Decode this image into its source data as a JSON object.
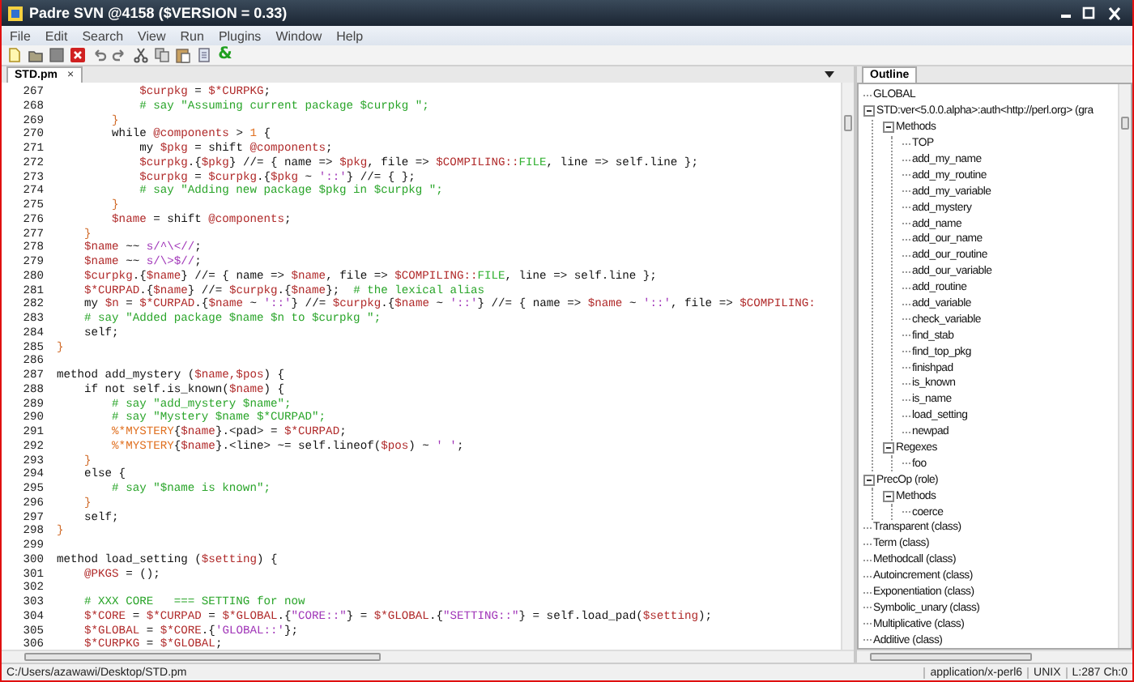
{
  "window": {
    "title": "Padre SVN @4158 ($VERSION = 0.33)"
  },
  "menu": [
    "File",
    "Edit",
    "Search",
    "View",
    "Run",
    "Plugins",
    "Window",
    "Help"
  ],
  "toolbar": [
    {
      "kind": "new"
    },
    {
      "kind": "open"
    },
    {
      "kind": "save"
    },
    {
      "kind": "close"
    },
    {
      "kind": "undo"
    },
    {
      "kind": "redo"
    },
    {
      "kind": "cut"
    },
    {
      "kind": "copy"
    },
    {
      "kind": "paste"
    },
    {
      "kind": "doc"
    },
    {
      "kind": "glyph",
      "text": "&"
    }
  ],
  "editor_tabs": [
    {
      "label": "STD.pm",
      "close": "×",
      "selected": true
    }
  ],
  "editor": {
    "lines": [
      {
        "number": "267",
        "segments": [
          {
            "kind": "var",
            "text": "            $curpkg"
          },
          {
            "kind": "plain",
            "text": " = "
          },
          {
            "kind": "var",
            "text": "$*CURPKG"
          },
          {
            "kind": "plain",
            "text": ";"
          }
        ]
      },
      {
        "number": "268",
        "segments": [
          {
            "kind": "comment",
            "text": "            # say \"Assuming current package $curpkg \";"
          }
        ]
      },
      {
        "number": "269",
        "segments": [
          {
            "kind": "brace",
            "text": "        }"
          }
        ]
      },
      {
        "number": "270",
        "segments": [
          {
            "kind": "plain",
            "text": "        while "
          },
          {
            "kind": "var",
            "text": "@components"
          },
          {
            "kind": "plain",
            "text": " > "
          },
          {
            "kind": "number",
            "text": "1"
          },
          {
            "kind": "plain",
            "text": " {"
          }
        ]
      },
      {
        "number": "271",
        "segments": [
          {
            "kind": "plain",
            "text": "            my "
          },
          {
            "kind": "var",
            "text": "$pkg"
          },
          {
            "kind": "plain",
            "text": " = shift "
          },
          {
            "kind": "var",
            "text": "@components"
          },
          {
            "kind": "plain",
            "text": ";"
          }
        ]
      },
      {
        "number": "272",
        "segments": [
          {
            "kind": "var",
            "text": "            $curpkg"
          },
          {
            "kind": "plain",
            "text": ".{"
          },
          {
            "kind": "var",
            "text": "$pkg"
          },
          {
            "kind": "plain",
            "text": "} //= { name => "
          },
          {
            "kind": "var",
            "text": "$pkg"
          },
          {
            "kind": "plain",
            "text": ", file => "
          },
          {
            "kind": "var",
            "text": "$COMPILING::"
          },
          {
            "kind": "const",
            "text": "FILE"
          },
          {
            "kind": "plain",
            "text": ", line => self.line };"
          }
        ]
      },
      {
        "number": "273",
        "segments": [
          {
            "kind": "var",
            "text": "            $curpkg"
          },
          {
            "kind": "plain",
            "text": " = "
          },
          {
            "kind": "var",
            "text": "$curpkg"
          },
          {
            "kind": "plain",
            "text": ".{"
          },
          {
            "kind": "var",
            "text": "$pkg"
          },
          {
            "kind": "plain",
            "text": " ~ "
          },
          {
            "kind": "string",
            "text": "'::'"
          },
          {
            "kind": "plain",
            "text": "} //= { };"
          }
        ]
      },
      {
        "number": "274",
        "segments": [
          {
            "kind": "comment",
            "text": "            # say \"Adding new package $pkg in $curpkg \";"
          }
        ]
      },
      {
        "number": "275",
        "segments": [
          {
            "kind": "brace",
            "text": "        }"
          }
        ]
      },
      {
        "number": "276",
        "segments": [
          {
            "kind": "var",
            "text": "        $name"
          },
          {
            "kind": "plain",
            "text": " = shift "
          },
          {
            "kind": "var",
            "text": "@components"
          },
          {
            "kind": "plain",
            "text": ";"
          }
        ]
      },
      {
        "number": "277",
        "segments": [
          {
            "kind": "brace",
            "text": "    }"
          }
        ]
      },
      {
        "number": "278",
        "segments": [
          {
            "kind": "var",
            "text": "    $name"
          },
          {
            "kind": "plain",
            "text": " ~~ "
          },
          {
            "kind": "string",
            "text": "s/^\\<//"
          },
          {
            "kind": "plain",
            "text": ";"
          }
        ]
      },
      {
        "number": "279",
        "segments": [
          {
            "kind": "var",
            "text": "    $name"
          },
          {
            "kind": "plain",
            "text": " ~~ "
          },
          {
            "kind": "string",
            "text": "s/\\>$//"
          },
          {
            "kind": "plain",
            "text": ";"
          }
        ]
      },
      {
        "number": "280",
        "segments": [
          {
            "kind": "var",
            "text": "    $curpkg"
          },
          {
            "kind": "plain",
            "text": ".{"
          },
          {
            "kind": "var",
            "text": "$name"
          },
          {
            "kind": "plain",
            "text": "} //= { name => "
          },
          {
            "kind": "var",
            "text": "$name"
          },
          {
            "kind": "plain",
            "text": ", file => "
          },
          {
            "kind": "var",
            "text": "$COMPILING::"
          },
          {
            "kind": "const",
            "text": "FILE"
          },
          {
            "kind": "plain",
            "text": ", line => self.line };"
          }
        ]
      },
      {
        "number": "281",
        "segments": [
          {
            "kind": "var",
            "text": "    $*CURPAD"
          },
          {
            "kind": "plain",
            "text": ".{"
          },
          {
            "kind": "var",
            "text": "$name"
          },
          {
            "kind": "plain",
            "text": "} //= "
          },
          {
            "kind": "var",
            "text": "$curpkg"
          },
          {
            "kind": "plain",
            "text": ".{"
          },
          {
            "kind": "var",
            "text": "$name"
          },
          {
            "kind": "plain",
            "text": "};  "
          },
          {
            "kind": "comment",
            "text": "# the lexical alias"
          }
        ]
      },
      {
        "number": "282",
        "segments": [
          {
            "kind": "plain",
            "text": "    my "
          },
          {
            "kind": "var",
            "text": "$n"
          },
          {
            "kind": "plain",
            "text": " = "
          },
          {
            "kind": "var",
            "text": "$*CURPAD"
          },
          {
            "kind": "plain",
            "text": ".{"
          },
          {
            "kind": "var",
            "text": "$name"
          },
          {
            "kind": "plain",
            "text": " ~ "
          },
          {
            "kind": "string",
            "text": "'::'"
          },
          {
            "kind": "plain",
            "text": "} //= "
          },
          {
            "kind": "var",
            "text": "$curpkg"
          },
          {
            "kind": "plain",
            "text": ".{"
          },
          {
            "kind": "var",
            "text": "$name"
          },
          {
            "kind": "plain",
            "text": " ~ "
          },
          {
            "kind": "string",
            "text": "'::'"
          },
          {
            "kind": "plain",
            "text": "} //= { name => "
          },
          {
            "kind": "var",
            "text": "$name"
          },
          {
            "kind": "plain",
            "text": " ~ "
          },
          {
            "kind": "string",
            "text": "'::'"
          },
          {
            "kind": "plain",
            "text": ", file => "
          },
          {
            "kind": "var",
            "text": "$COMPILING:"
          }
        ]
      },
      {
        "number": "283",
        "segments": [
          {
            "kind": "comment",
            "text": "    # say \"Added package $name $n to $curpkg \";"
          }
        ]
      },
      {
        "number": "284",
        "segments": [
          {
            "kind": "plain",
            "text": "    self;"
          }
        ]
      },
      {
        "number": "285",
        "segments": [
          {
            "kind": "brace",
            "text": "}"
          }
        ]
      },
      {
        "number": "286"
      },
      {
        "number": "287",
        "segments": [
          {
            "kind": "plain",
            "text": "method add_mystery ("
          },
          {
            "kind": "var",
            "text": "$name,$pos"
          },
          {
            "kind": "plain",
            "text": ") {"
          }
        ]
      },
      {
        "number": "288",
        "segments": [
          {
            "kind": "plain",
            "text": "    if not self.is_known("
          },
          {
            "kind": "var",
            "text": "$name"
          },
          {
            "kind": "plain",
            "text": ") {"
          }
        ]
      },
      {
        "number": "289",
        "segments": [
          {
            "kind": "comment",
            "text": "        # say \"add_mystery $name\";"
          }
        ]
      },
      {
        "number": "290",
        "segments": [
          {
            "kind": "comment",
            "text": "        # say \"Mystery $name $*CURPAD\";"
          }
        ]
      },
      {
        "number": "291",
        "segments": [
          {
            "kind": "number",
            "text": "        %*MYSTERY"
          },
          {
            "kind": "plain",
            "text": "{"
          },
          {
            "kind": "var",
            "text": "$name"
          },
          {
            "kind": "plain",
            "text": "}.<pad> = "
          },
          {
            "kind": "var",
            "text": "$*CURPAD"
          },
          {
            "kind": "plain",
            "text": ";"
          }
        ]
      },
      {
        "number": "292",
        "segments": [
          {
            "kind": "number",
            "text": "        %*MYSTERY"
          },
          {
            "kind": "plain",
            "text": "{"
          },
          {
            "kind": "var",
            "text": "$name"
          },
          {
            "kind": "plain",
            "text": "}.<line> ~= self.lineof("
          },
          {
            "kind": "var",
            "text": "$pos"
          },
          {
            "kind": "plain",
            "text": ") ~ "
          },
          {
            "kind": "string",
            "text": "' '"
          },
          {
            "kind": "plain",
            "text": ";"
          }
        ]
      },
      {
        "number": "293",
        "segments": [
          {
            "kind": "brace",
            "text": "    }"
          }
        ]
      },
      {
        "number": "294",
        "segments": [
          {
            "kind": "plain",
            "text": "    else {"
          }
        ]
      },
      {
        "number": "295",
        "segments": [
          {
            "kind": "comment",
            "text": "        # say \"$name is known\";"
          }
        ]
      },
      {
        "number": "296",
        "segments": [
          {
            "kind": "brace",
            "text": "    }"
          }
        ]
      },
      {
        "number": "297",
        "segments": [
          {
            "kind": "plain",
            "text": "    self;"
          }
        ]
      },
      {
        "number": "298",
        "segments": [
          {
            "kind": "brace",
            "text": "}"
          }
        ]
      },
      {
        "number": "299"
      },
      {
        "number": "300",
        "segments": [
          {
            "kind": "plain",
            "text": "method load_setting ("
          },
          {
            "kind": "var",
            "text": "$setting"
          },
          {
            "kind": "plain",
            "text": ") {"
          }
        ]
      },
      {
        "number": "301",
        "segments": [
          {
            "kind": "var",
            "text": "    @PKGS"
          },
          {
            "kind": "plain",
            "text": " = ();"
          }
        ]
      },
      {
        "number": "302"
      },
      {
        "number": "303",
        "segments": [
          {
            "kind": "comment",
            "text": "    # XXX CORE   === SETTING for now"
          }
        ]
      },
      {
        "number": "304",
        "segments": [
          {
            "kind": "var",
            "text": "    $*CORE"
          },
          {
            "kind": "plain",
            "text": " = "
          },
          {
            "kind": "var",
            "text": "$*CURPAD"
          },
          {
            "kind": "plain",
            "text": " = "
          },
          {
            "kind": "var",
            "text": "$*GLOBAL"
          },
          {
            "kind": "plain",
            "text": ".{"
          },
          {
            "kind": "string",
            "text": "\"CORE::\""
          },
          {
            "kind": "plain",
            "text": "} = "
          },
          {
            "kind": "var",
            "text": "$*GLOBAL"
          },
          {
            "kind": "plain",
            "text": ".{"
          },
          {
            "kind": "string",
            "text": "\"SETTING::\""
          },
          {
            "kind": "plain",
            "text": "} = self.load_pad("
          },
          {
            "kind": "var",
            "text": "$setting"
          },
          {
            "kind": "plain",
            "text": ");"
          }
        ]
      },
      {
        "number": "305",
        "segments": [
          {
            "kind": "var",
            "text": "    $*GLOBAL"
          },
          {
            "kind": "plain",
            "text": " = "
          },
          {
            "kind": "var",
            "text": "$*CORE"
          },
          {
            "kind": "plain",
            "text": ".{"
          },
          {
            "kind": "string",
            "text": "'GLOBAL::'"
          },
          {
            "kind": "plain",
            "text": "};"
          }
        ]
      },
      {
        "number": "306",
        "segments": [
          {
            "kind": "var",
            "text": "    $*CURPKG"
          },
          {
            "kind": "plain",
            "text": " = "
          },
          {
            "kind": "var",
            "text": "$*GLOBAL"
          },
          {
            "kind": "plain",
            "text": ";"
          }
        ]
      }
    ]
  },
  "outline": {
    "tab": "Outline",
    "tree": [
      {
        "label": "GLOBAL"
      },
      {
        "label": "STD:ver<5.0.0.alpha>:auth<http://perl.org> (gra",
        "expanded": true,
        "children": [
          {
            "label": "Methods",
            "expanded": true,
            "children": [
              {
                "label": "TOP"
              },
              {
                "label": "add_my_name"
              },
              {
                "label": "add_my_routine"
              },
              {
                "label": "add_my_variable"
              },
              {
                "label": "add_mystery"
              },
              {
                "label": "add_name"
              },
              {
                "label": "add_our_name"
              },
              {
                "label": "add_our_routine"
              },
              {
                "label": "add_our_variable"
              },
              {
                "label": "add_routine"
              },
              {
                "label": "add_variable"
              },
              {
                "label": "check_variable"
              },
              {
                "label": "find_stab"
              },
              {
                "label": "find_top_pkg"
              },
              {
                "label": "finishpad"
              },
              {
                "label": "is_known"
              },
              {
                "label": "is_name"
              },
              {
                "label": "load_setting"
              },
              {
                "label": "newpad"
              }
            ]
          },
          {
            "label": "Regexes",
            "expanded": true,
            "children": [
              {
                "label": "foo"
              }
            ]
          }
        ]
      },
      {
        "label": "PrecOp (role)",
        "expanded": true,
        "children": [
          {
            "label": "Methods",
            "expanded": true,
            "children": [
              {
                "label": "coerce"
              }
            ]
          }
        ]
      },
      {
        "label": "Transparent (class)"
      },
      {
        "label": "Term (class)"
      },
      {
        "label": "Methodcall (class)"
      },
      {
        "label": "Autoincrement (class)"
      },
      {
        "label": "Exponentiation (class)"
      },
      {
        "label": "Symbolic_unary (class)"
      },
      {
        "label": "Multiplicative (class)"
      },
      {
        "label": "Additive (class)"
      }
    ]
  },
  "status_bar": {
    "path": "C:/Users/azawawi/Desktop/STD.pm",
    "mime": "application/x-perl6",
    "newline": "UNIX",
    "position": "L:287 Ch:0"
  }
}
